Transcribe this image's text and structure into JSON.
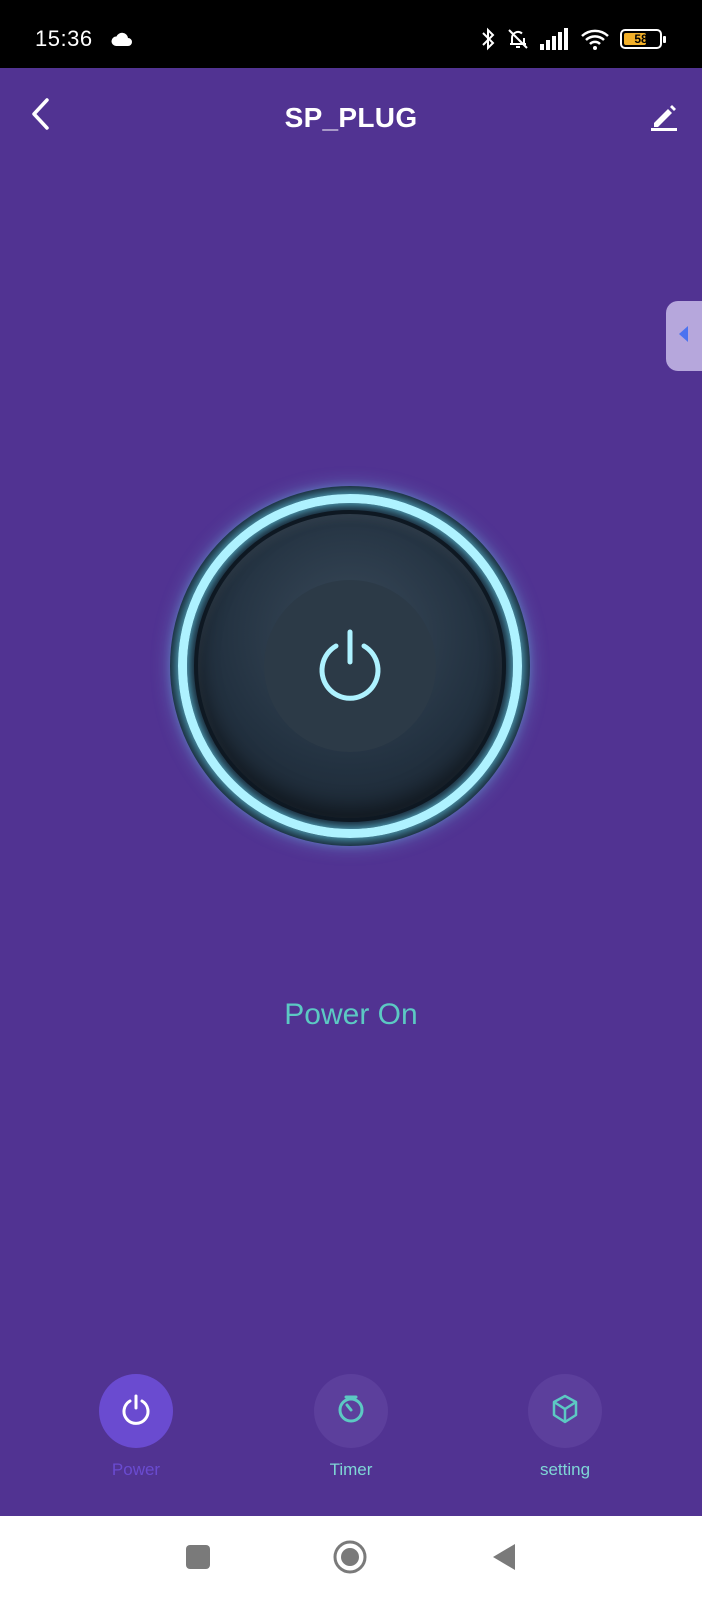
{
  "status_bar": {
    "time": "15:36",
    "battery_level": "58",
    "icons": [
      "cloud-icon",
      "bluetooth-icon",
      "bell-off-icon",
      "signal-icon",
      "wifi-icon",
      "battery-icon"
    ]
  },
  "header": {
    "title": "SP_PLUG",
    "back_icon": "chevron-left-icon",
    "edit_icon": "pencil-icon"
  },
  "side_handle_icon": "caret-left-icon",
  "power_button": {
    "icon": "power-icon",
    "status": "Power On"
  },
  "tabs": [
    {
      "label": "Power",
      "icon": "power-icon",
      "active": true
    },
    {
      "label": "Timer",
      "icon": "timer-icon",
      "active": false
    },
    {
      "label": "setting",
      "icon": "cube-icon",
      "active": false
    }
  ],
  "colors": {
    "background": "#513392",
    "accent_teal": "#5cc9c3",
    "glow_ring": "#aef2ff",
    "tab_active": "#6a4bd0"
  }
}
